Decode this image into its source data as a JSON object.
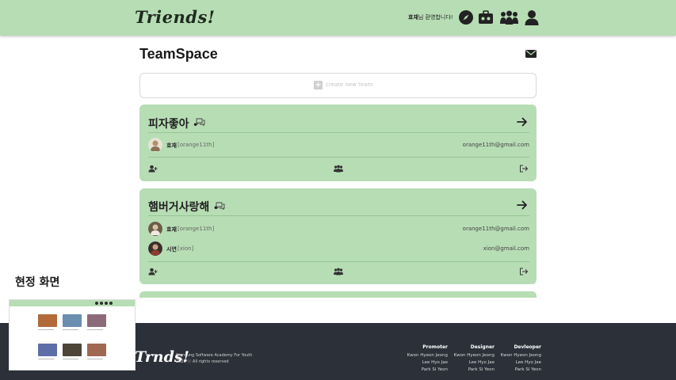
{
  "header": {
    "logo": "Triends!",
    "welcome_name": "효재",
    "welcome_suffix": "님 환영합니다!",
    "nav_icons": [
      "compass-icon",
      "toolbox-icon",
      "group-icon",
      "user-icon"
    ]
  },
  "page": {
    "title": "TeamSpace",
    "create_label": "create new team",
    "create_icon": "plus-square-icon"
  },
  "teams": [
    {
      "name": "피자좋아",
      "dot": "•",
      "members": [
        {
          "name": "효재",
          "id": "[orange11th]",
          "email": "orange11th@gmail.com"
        }
      ]
    },
    {
      "name": "햄버거사랑해",
      "dot": "•",
      "members": [
        {
          "name": "효재",
          "id": "[orange11th]",
          "email": "orange11th@gmail.com"
        },
        {
          "name": "시연",
          "id": "[xion]",
          "email": "xion@gmail.com"
        }
      ]
    }
  ],
  "overlay": {
    "label": "현정 화면"
  },
  "footer": {
    "logo": "Trnds!",
    "sub_line1": "Samsung Software Academy For Youth",
    "sub_line2": "2023 ⓒ All rights reserved",
    "columns": [
      {
        "head": "Promoter",
        "names": [
          "Kwon Hyeon Jeong",
          "Lee Hyo Jae",
          "Park Si Yeon"
        ]
      },
      {
        "head": "Designer",
        "names": [
          "Kwon Hyeon Jeong",
          "Lee Hyo Jae",
          "Park Si Yeon"
        ]
      },
      {
        "head": "Devleoper",
        "names": [
          "Kwon Hyeon Jeong",
          "Lee Hyo Jae",
          "Park Si Yeon"
        ]
      }
    ]
  },
  "colors": {
    "accent_green": "#b7ddb4",
    "footer_bg": "#2b3039"
  }
}
